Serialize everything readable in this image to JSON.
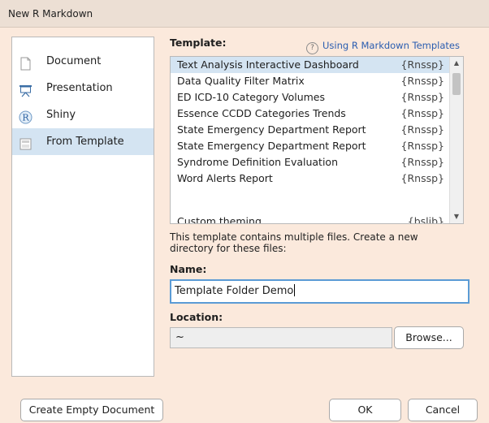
{
  "window": {
    "title": "New R Markdown"
  },
  "types": [
    {
      "label": "Document",
      "icon": "document-icon",
      "selected": false
    },
    {
      "label": "Presentation",
      "icon": "presentation-icon",
      "selected": false
    },
    {
      "label": "Shiny",
      "icon": "shiny-icon",
      "selected": false
    },
    {
      "label": "From Template",
      "icon": "template-icon",
      "selected": true
    }
  ],
  "template_section": {
    "label": "Template:",
    "help_link": "Using R Markdown Templates",
    "items": [
      {
        "name": "Text Analysis Interactive Dashboard",
        "package": "{Rnssp}",
        "selected": true
      },
      {
        "name": "Data Quality Filter Matrix",
        "package": "{Rnssp}"
      },
      {
        "name": "ED ICD-10 Category Volumes",
        "package": "{Rnssp}"
      },
      {
        "name": "Essence CCDD Categories Trends",
        "package": "{Rnssp}"
      },
      {
        "name": "State Emergency Department Report",
        "package": "{Rnssp}"
      },
      {
        "name": "State Emergency Department Report",
        "package": "{Rnssp}"
      },
      {
        "name": "Syndrome Definition Evaluation",
        "package": "{Rnssp}"
      },
      {
        "name": "Word Alerts Report",
        "package": "{Rnssp}"
      },
      {
        "name": "Custom theming",
        "package": "{bslib}"
      }
    ]
  },
  "info_text": "This template contains multiple files. Create a new directory for these files:",
  "name_field": {
    "label": "Name:",
    "value": "Template Folder Demo"
  },
  "location_field": {
    "label": "Location:",
    "value": "~",
    "browse_label": "Browse..."
  },
  "buttons": {
    "create_empty": "Create Empty Document",
    "ok": "OK",
    "cancel": "Cancel"
  },
  "colors": {
    "selection": "#d4e4f2",
    "focus_border": "#5b9bd5",
    "link": "#2a5db0",
    "background": "#fbe9dc"
  }
}
